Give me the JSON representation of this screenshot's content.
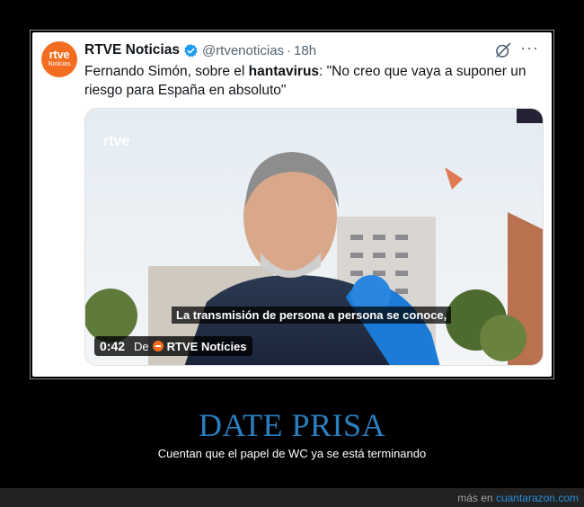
{
  "tweet": {
    "avatar_line1": "rtve",
    "avatar_line2": "Noticias",
    "display_name": "RTVE Noticias",
    "handle": "@rtvenoticias",
    "separator": "·",
    "time": "18h",
    "more": "···",
    "text_part1": "Fernando Simón, sobre el ",
    "text_bold": "hantavirus",
    "text_part2": ": \"No creo que vaya a suponer un riesgo para España en absoluto\""
  },
  "media": {
    "watermark": "rtve",
    "subtitle": "La transmisión de persona a persona se conoce,",
    "duration": "0:42",
    "from_label": "De",
    "source_name": "RTVE Notícies"
  },
  "caption": {
    "title": "DATE PRISA",
    "subtitle": "Cuentan que el papel de WC ya se está terminando"
  },
  "footer": {
    "prefix": "más en ",
    "site": "cuantarazon.com"
  },
  "colors": {
    "brand_orange": "#f36d21",
    "verified_blue": "#1d9bf0",
    "caption_blue": "#2a7fc1",
    "link_blue": "#2a8fd8"
  }
}
